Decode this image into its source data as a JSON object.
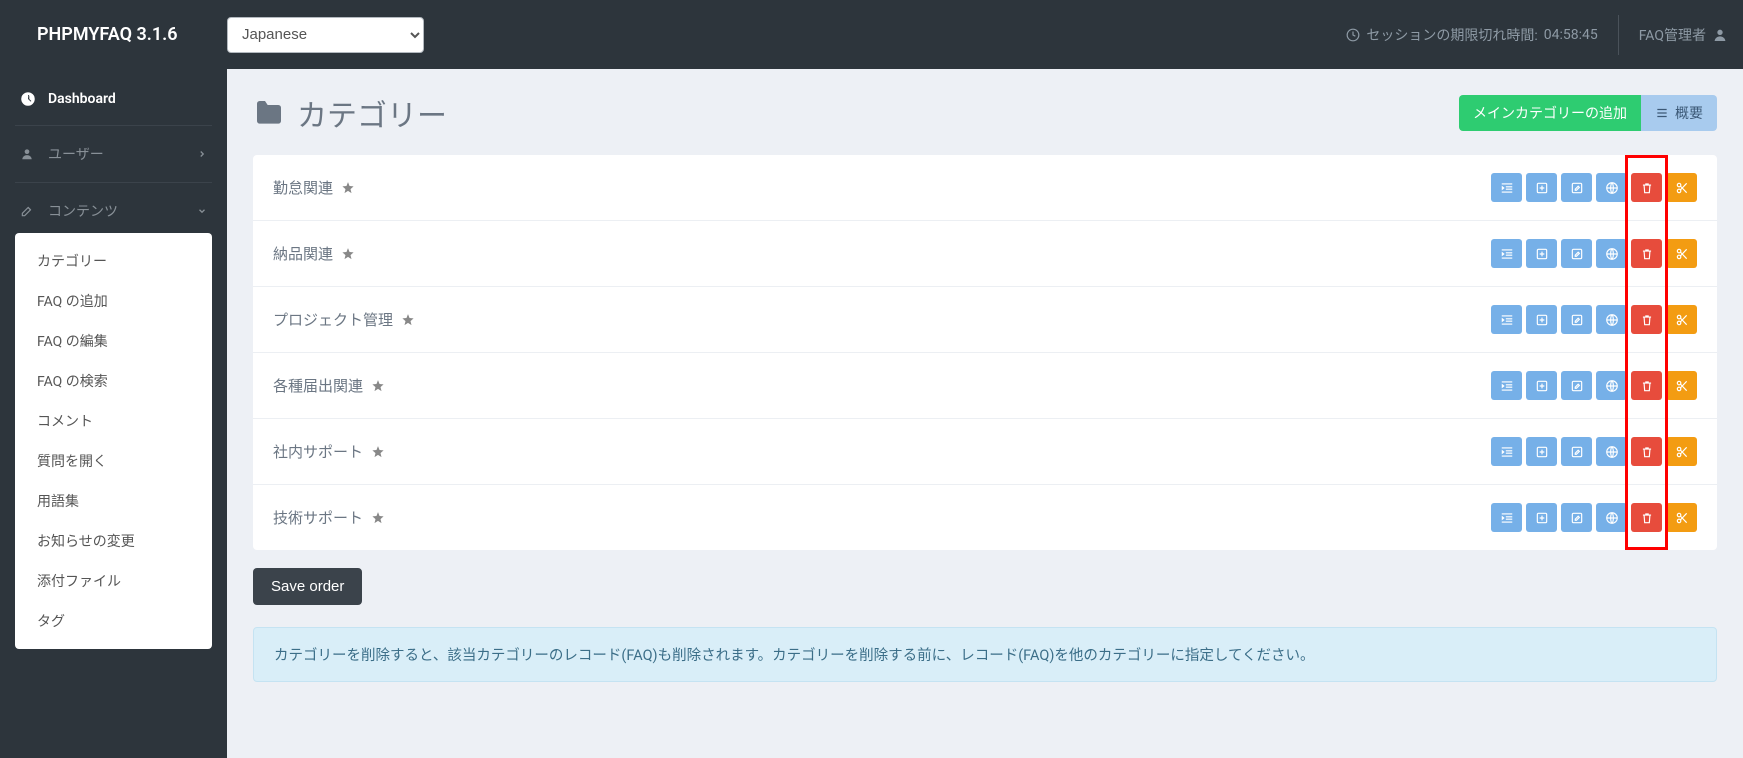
{
  "brand": "PHPMYFAQ 3.1.6",
  "language_selected": "Japanese",
  "session_label": "セッションの期限切れ時間:",
  "session_time": "04:58:45",
  "user_label": "FAQ管理者",
  "sidebar": {
    "dashboard": "Dashboard",
    "users": "ユーザー",
    "content": "コンテンツ",
    "submenu": [
      "カテゴリー",
      "FAQ の追加",
      "FAQ の編集",
      "FAQ の検索",
      "コメント",
      "質問を開く",
      "用語集",
      "お知らせの変更",
      "添付ファイル",
      "タグ"
    ]
  },
  "page": {
    "title": "カテゴリー",
    "add_main": "メインカテゴリーの追加",
    "overview": "概要"
  },
  "categories": [
    "勤怠関連",
    "納品関連",
    "プロジェクト管理",
    "各種届出関連",
    "社内サポート",
    "技術サポート"
  ],
  "save_order": "Save order",
  "alert_text": "カテゴリーを削除すると、該当カテゴリーのレコード(FAQ)も削除されます。カテゴリーを削除する前に、レコード(FAQ)を他のカテゴリーに指定してください。",
  "icons": {
    "folder": "folder-icon",
    "list": "list-icon",
    "plus": "plus-icon",
    "edit": "edit-icon",
    "globe": "globe-icon",
    "trash": "trash-icon",
    "cut": "cut-icon",
    "star": "star-icon",
    "clock": "clock-icon",
    "user": "user-icon",
    "dashboard": "dashboard-icon",
    "chevron_right": "chevron-right-icon",
    "chevron_down": "chevron-down-icon"
  }
}
